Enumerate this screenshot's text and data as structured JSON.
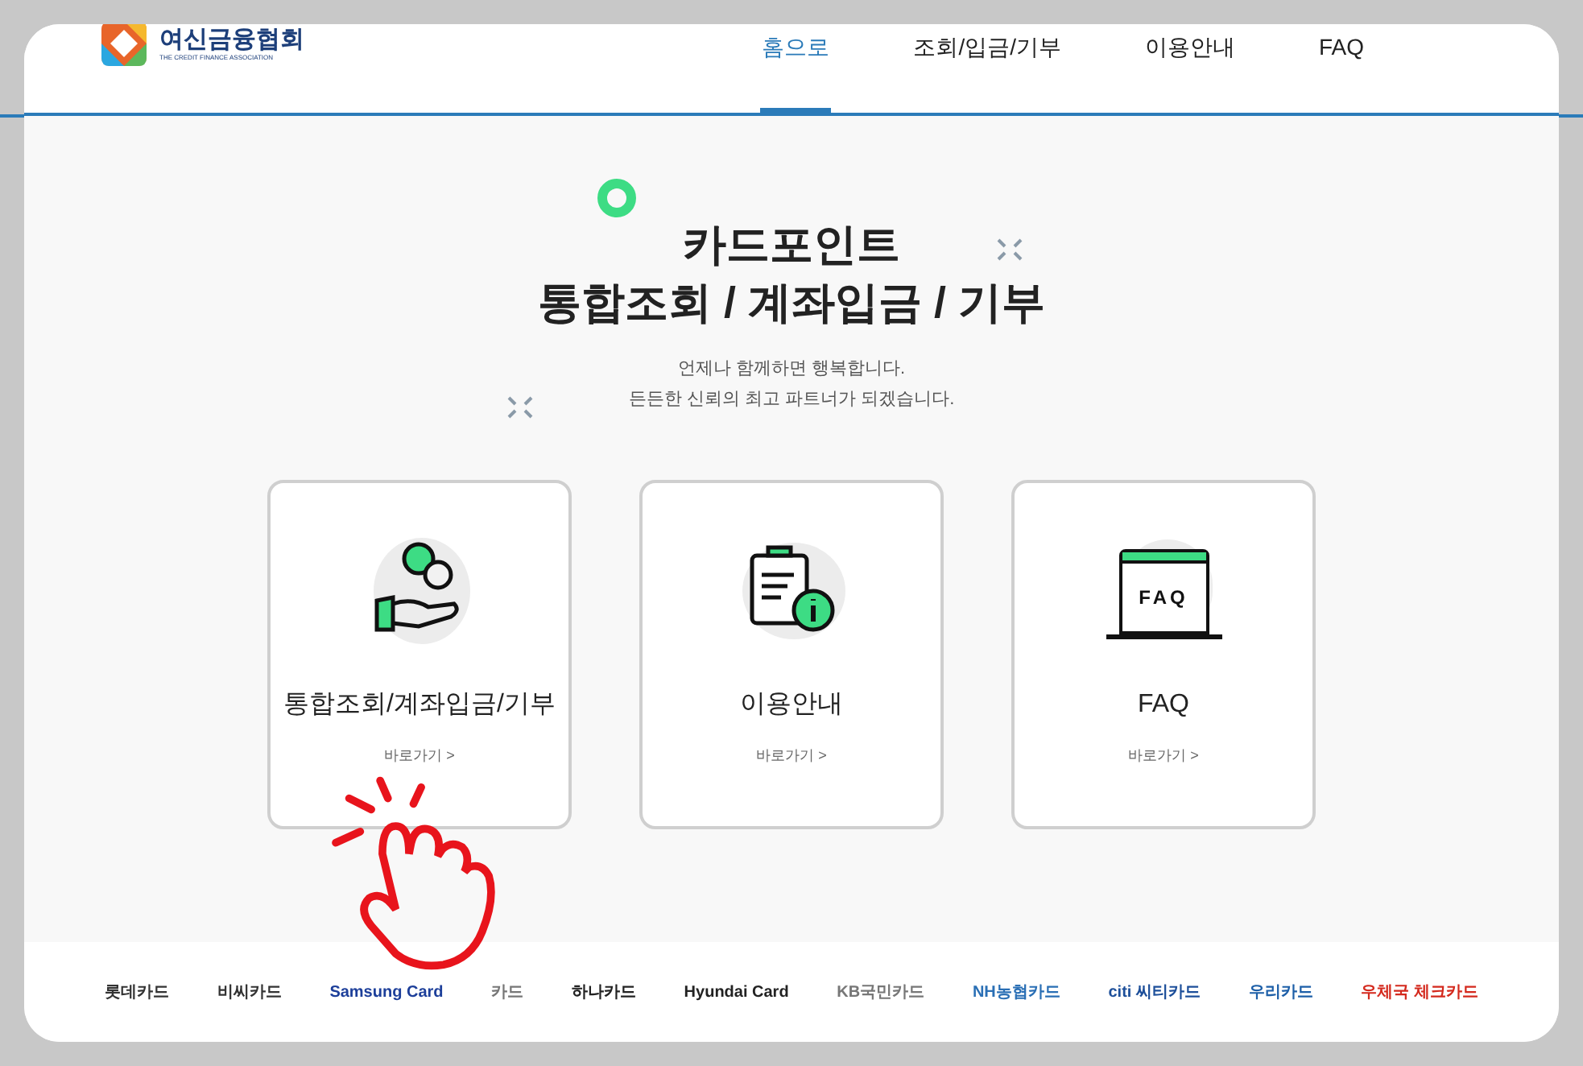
{
  "header": {
    "logo": {
      "name": "여신금융협회",
      "subtitle": "THE CREDIT FINANCE ASSOCIATION"
    },
    "nav": [
      {
        "label": "홈으로",
        "selected": true
      },
      {
        "label": "조회/입금/기부",
        "selected": false
      },
      {
        "label": "이용안내",
        "selected": false
      },
      {
        "label": "FAQ",
        "selected": false
      }
    ]
  },
  "hero": {
    "title_lines": [
      "카드포인트",
      "통합조회 / 계좌입금 / 기부"
    ],
    "subtitle_lines": [
      "언제나 함께하면 행복합니다.",
      "든든한 신뢰의 최고 파트너가 되겠습니다."
    ]
  },
  "cards": [
    {
      "kind": "coins",
      "title": "통합조회/계좌입금/기부",
      "link": "바로가기 >"
    },
    {
      "kind": "guide",
      "title": "이용안내",
      "link": "바로가기 >"
    },
    {
      "kind": "faq",
      "title": "FAQ",
      "link": "바로가기 >",
      "icon_text": "FAQ"
    }
  ],
  "partners": [
    {
      "name": "롯데카드",
      "color": "#333333"
    },
    {
      "name": "비씨카드",
      "color": "#333333"
    },
    {
      "name": "Samsung Card",
      "color": "#1d3f9a"
    },
    {
      "name": "카드",
      "color": "#777777"
    },
    {
      "name": "하나카드",
      "color": "#222222"
    },
    {
      "name": "Hyundai Card",
      "color": "#222222"
    },
    {
      "name": "KB국민카드",
      "color": "#777777"
    },
    {
      "name": "NH농협카드",
      "color": "#2a6fb5"
    },
    {
      "name": "citi 씨티카드",
      "color": "#1d4f9a"
    },
    {
      "name": "우리카드",
      "color": "#1d5fa8"
    },
    {
      "name": "우체국 체크카드",
      "color": "#d42a1e"
    }
  ]
}
